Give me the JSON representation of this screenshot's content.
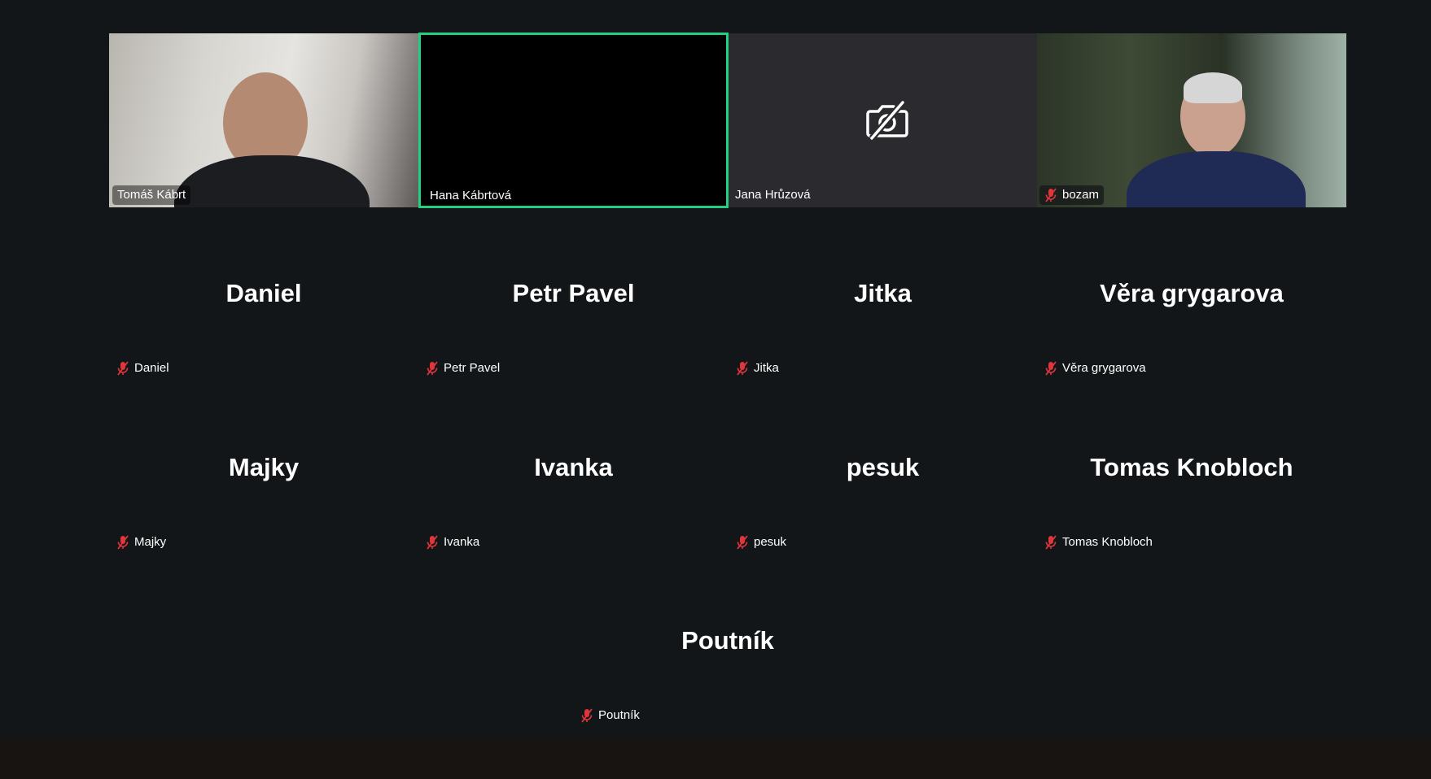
{
  "top_row": [
    {
      "name": "Tomáš Kábrt",
      "type": "video",
      "muted": false
    },
    {
      "name": "Hana Kábrtová",
      "type": "active-speaker",
      "muted": false
    },
    {
      "name": "Jana Hrůzová",
      "type": "camera-off",
      "muted": false,
      "icon": "camera-off-icon"
    },
    {
      "name": "bozam",
      "type": "video",
      "muted": true
    }
  ],
  "grid": [
    {
      "display": "Daniel",
      "label": "Daniel",
      "muted": true
    },
    {
      "display": "Petr Pavel",
      "label": "Petr Pavel",
      "muted": true
    },
    {
      "display": "Jitka",
      "label": "Jitka",
      "muted": true
    },
    {
      "display": "Věra grygarova",
      "label": "Věra grygarova",
      "muted": true
    },
    {
      "display": "Majky",
      "label": "Majky",
      "muted": true
    },
    {
      "display": "Ivanka",
      "label": "Ivanka",
      "muted": true
    },
    {
      "display": "pesuk",
      "label": "pesuk",
      "muted": true
    },
    {
      "display": "Tomas Knobloch",
      "label": "Tomas Knobloch",
      "muted": true
    },
    {
      "display": "Poutník",
      "label": "Poutník",
      "muted": true
    }
  ],
  "colors": {
    "background": "#131619",
    "active_speaker_border": "#22d07f",
    "muted_icon": "#e0353b",
    "bottom_bar": "#171411"
  }
}
